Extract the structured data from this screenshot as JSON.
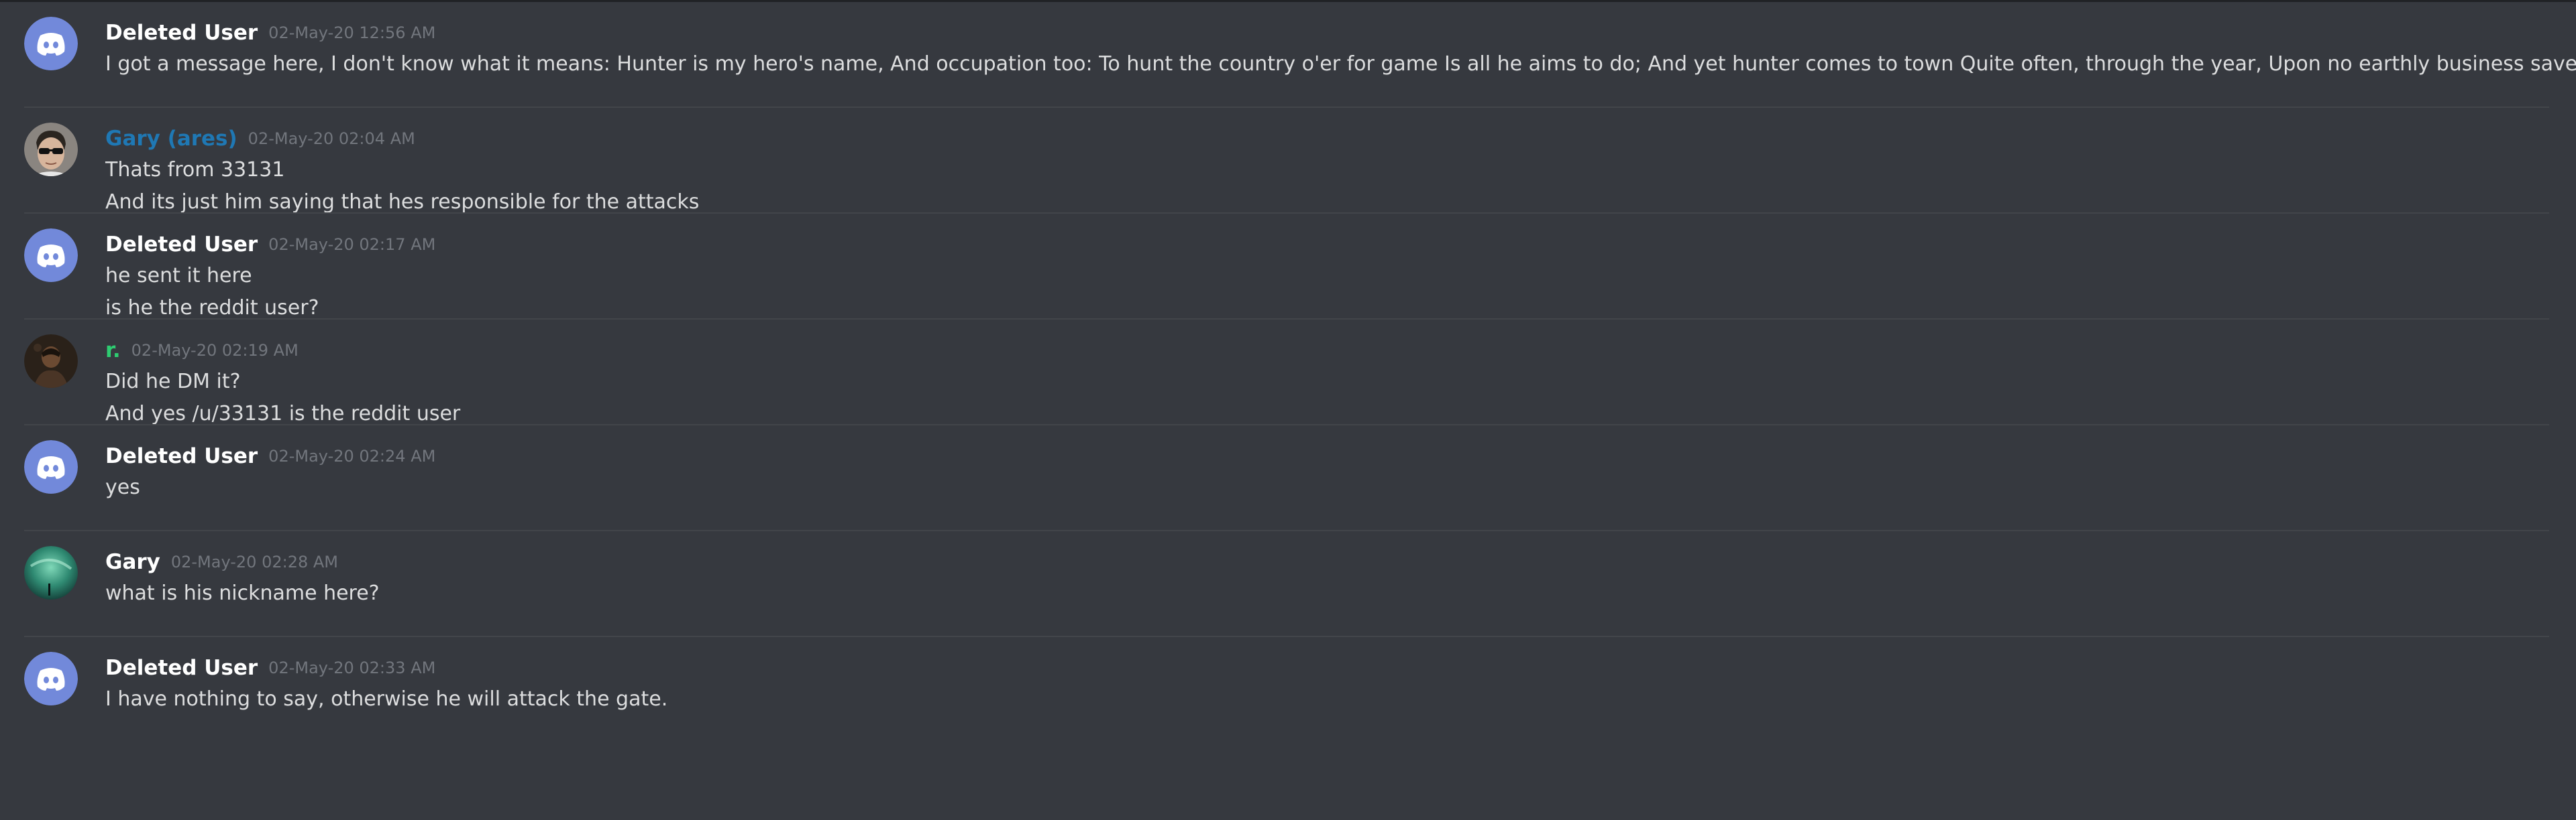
{
  "colors": {
    "background": "#36393f",
    "text": "#dcddde",
    "timestamp": "#72767d",
    "username_default": "#ffffff",
    "username_blue": "#1f78b4",
    "username_green": "#2ecc71",
    "discord_blurple": "#7289da"
  },
  "messages": [
    {
      "author": "Deleted User",
      "author_color": "#ffffff",
      "avatar": "discord-default-avatar",
      "timestamp": "02-May-20 12:56 AM",
      "lines": [
        "I got a message here, I don't know what it means: Hunter is my hero's name, And occupation too: To hunt the country o'er for game Is all he aims to do; And yet hunter comes to town Quite often, through the year, Upon no earthly business save To kill the people here."
      ]
    },
    {
      "author": "Gary (ares)",
      "author_color": "#1f78b4",
      "avatar": "photo-sunglasses-avatar",
      "timestamp": "02-May-20 02:04 AM",
      "lines": [
        "Thats from 33131",
        "And its just him saying that hes responsible for the attacks"
      ]
    },
    {
      "author": "Deleted User",
      "author_color": "#ffffff",
      "avatar": "discord-default-avatar",
      "timestamp": "02-May-20 02:17 AM",
      "lines": [
        "he sent it here",
        "is he the reddit user?"
      ]
    },
    {
      "author": "r.",
      "author_color": "#2ecc71",
      "avatar": "photo-dark-avatar",
      "timestamp": "02-May-20 02:19 AM",
      "lines": [
        "Did he DM it?",
        "And yes /u/33131 is the reddit user"
      ]
    },
    {
      "author": "Deleted User",
      "author_color": "#ffffff",
      "avatar": "discord-default-avatar",
      "timestamp": "02-May-20 02:24 AM",
      "lines": [
        "yes"
      ]
    },
    {
      "author": "Gary",
      "author_color": "#ffffff",
      "avatar": "aurora-avatar",
      "timestamp": "02-May-20 02:28 AM",
      "lines": [
        "what is his nickname here?"
      ]
    },
    {
      "author": "Deleted User",
      "author_color": "#ffffff",
      "avatar": "discord-default-avatar",
      "timestamp": "02-May-20 02:33 AM",
      "lines": [
        "I have nothing to say, otherwise he will attack the gate."
      ]
    }
  ]
}
